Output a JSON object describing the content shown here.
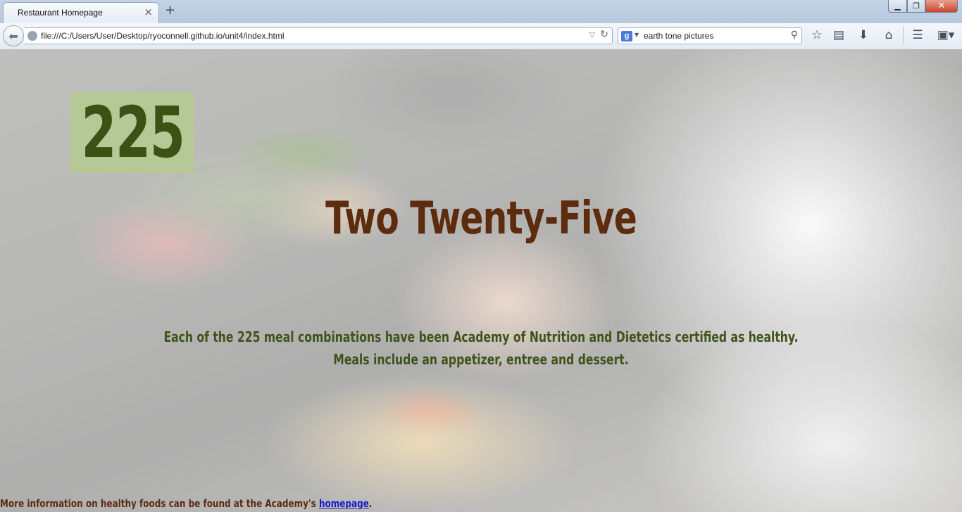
{
  "browser": {
    "tab_title": "Restaurant Homepage",
    "tab_close": "×",
    "new_tab": "+",
    "window_buttons": {
      "minimize": "▁",
      "maximize": "❐",
      "close": "✕"
    },
    "url": "file:///C:/Users/User/Desktop/ryoconnell.github.io/unit4/index.html",
    "search_engine_icon": "google-icon",
    "search_engine_glyph": "g",
    "search_text": "earth tone pictures",
    "toolbar_icons": [
      "star-icon",
      "reading-list-icon",
      "download-icon",
      "home-icon",
      "menu-icon",
      "addon-icon"
    ]
  },
  "page": {
    "logo_text": "225",
    "title": "Two Twenty-Five",
    "tagline_line1": "Each of the 225 meal combinations have been Academy of Nutrition and Dietetics certified as healthy.",
    "tagline_line2": "Meals include an appetizer, entree and dessert.",
    "footer_text": "More information on healthy foods can be found at the Academy's ",
    "footer_link": "homepage",
    "footer_end": "."
  },
  "colors": {
    "logo_bg": "#b5c895",
    "logo_text": "#3b5214",
    "title": "#5d2b0e",
    "tagline": "#3f531a",
    "link": "#1a1acc"
  }
}
